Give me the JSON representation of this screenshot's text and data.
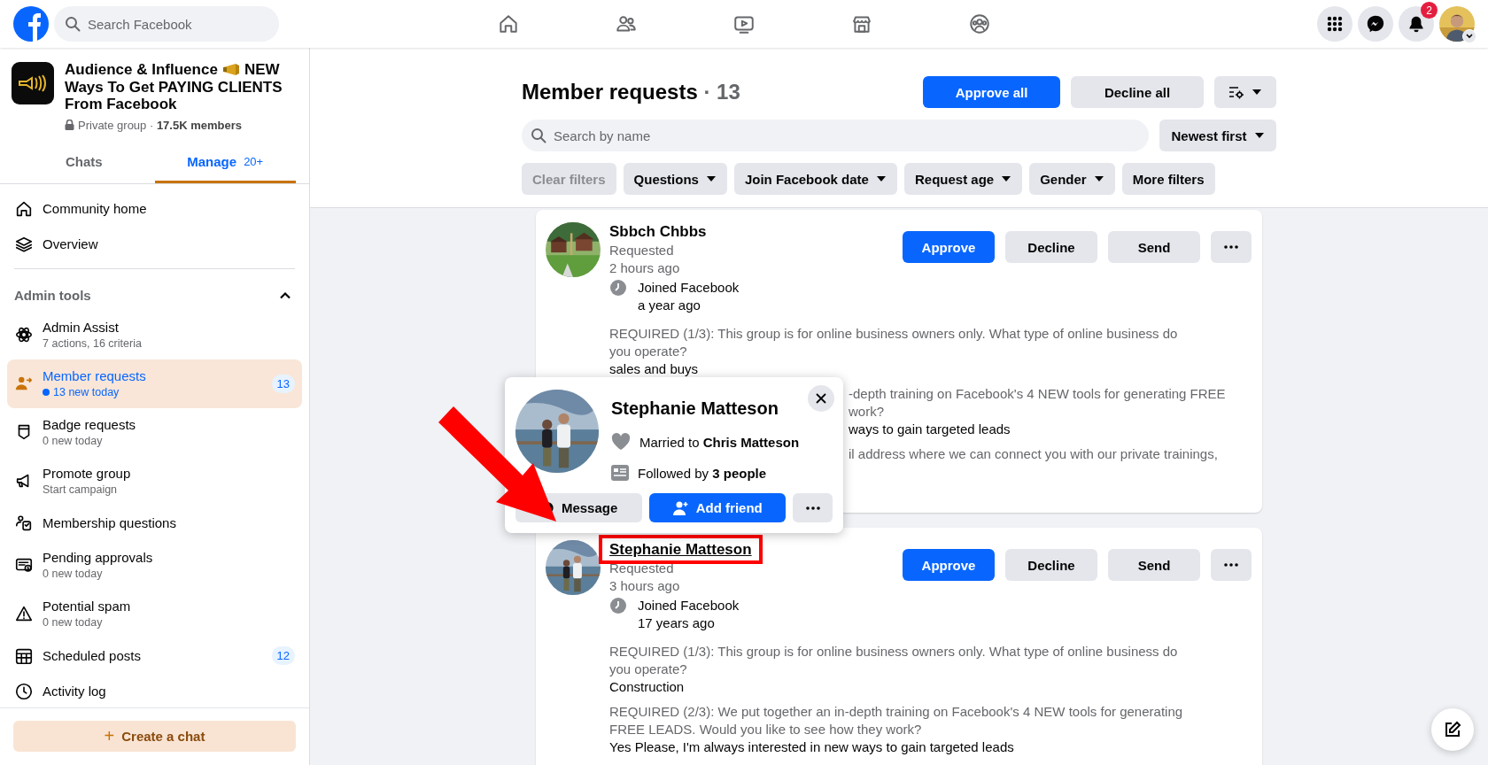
{
  "top_bar": {
    "search": {
      "placeholder": "Search Facebook"
    },
    "nav": [
      {
        "kind": "home"
      },
      {
        "kind": "friends"
      },
      {
        "kind": "video"
      },
      {
        "kind": "marketplace"
      },
      {
        "kind": "groups"
      }
    ],
    "notification_count": "2"
  },
  "group": {
    "name_parts": [
      "Audience & Influence",
      "NEW",
      "Ways To Get PAYING CLIENTS From Facebook"
    ],
    "meta": "Private group · **17.5K members**"
  },
  "tabs": [
    {
      "label": "Chats",
      "selected": false
    },
    {
      "label": "Manage",
      "badge": "20+",
      "selected": true
    }
  ],
  "menu": [
    {
      "kind": "home",
      "label": "Community home"
    },
    {
      "kind": "overview",
      "label": "Overview"
    }
  ],
  "admin_tools": {
    "title": "Admin tools",
    "expanded": true,
    "items": [
      {
        "kind": "admin-assist",
        "label": "Admin Assist",
        "detail": "7 actions, 16 criteria",
        "selected": false
      },
      {
        "kind": "member-requests",
        "label": "Member requests",
        "detail": "13 new today",
        "unread": true,
        "count": "13",
        "selected": true
      },
      {
        "kind": "badge",
        "label": "Badge requests",
        "detail": "0 new today",
        "selected": false
      },
      {
        "kind": "promote",
        "label": "Promote group",
        "detail": "Start campaign",
        "selected": false
      },
      {
        "kind": "questions",
        "label": "Membership questions",
        "selected": false
      },
      {
        "kind": "pending",
        "label": "Pending approvals",
        "detail": "0 new today",
        "selected": false
      },
      {
        "kind": "spam",
        "label": "Potential spam",
        "detail": "0 new today",
        "selected": false
      },
      {
        "kind": "scheduled",
        "label": "Scheduled posts",
        "count": "12",
        "selected": false
      },
      {
        "kind": "activity",
        "label": "Activity log",
        "selected": false
      }
    ]
  },
  "create_chat": {
    "icon": "+",
    "label": "Create a chat"
  },
  "requests_panel": {
    "title": "Member requests",
    "count": "· 13",
    "approve_all": "Approve all",
    "decline_all": "Decline all",
    "search": {
      "placeholder": "Search by name"
    },
    "sort": "Newest first",
    "filters": [
      {
        "label": "Clear filters",
        "disabled": true,
        "dropdown": false
      },
      {
        "label": "Questions",
        "disabled": false,
        "dropdown": true
      },
      {
        "label": "Join Facebook date",
        "disabled": false,
        "dropdown": true
      },
      {
        "label": "Request age",
        "disabled": false,
        "dropdown": true
      },
      {
        "label": "Gender",
        "disabled": false,
        "dropdown": true
      },
      {
        "label": "More filters",
        "disabled": false,
        "dropdown": false
      }
    ]
  },
  "requests": [
    {
      "name": "Sbbch Chbbs",
      "highlighted": false,
      "status": "Requested",
      "time": "2 hours ago",
      "joined_label": "Joined Facebook",
      "joined_value": "a year ago",
      "actions": [
        {
          "label": "Approve",
          "kind": "primary"
        },
        {
          "label": "Decline",
          "kind": "secondary"
        },
        {
          "label": "Send",
          "kind": "secondary"
        }
      ],
      "answers": [
        {
          "covered": false,
          "lines": [
            "REQUIRED (1/3): This group is for online business owners only. What type of online business do you operate?"
          ],
          "answer": "sales and buys"
        },
        {
          "covered": true,
          "lines": [
            "-depth training on Facebook's 4 NEW tools for generating FREE",
            "work?"
          ],
          "answer": "ways to gain targeted leads"
        },
        {
          "covered": true,
          "lines": [
            "il address where we can connect you with our private trainings,"
          ]
        }
      ]
    },
    {
      "name": "Stephanie Matteson",
      "highlighted": true,
      "status": "Requested",
      "time": "3 hours ago",
      "joined_label": "Joined Facebook",
      "joined_value": "17 years ago",
      "actions": [
        {
          "label": "Approve",
          "kind": "primary"
        },
        {
          "label": "Decline",
          "kind": "secondary"
        },
        {
          "label": "Send",
          "kind": "secondary"
        }
      ],
      "answers": [
        {
          "covered": false,
          "lines": [
            "REQUIRED (1/3): This group is for online business owners only. What type of online business do you operate?"
          ],
          "answer": "Construction"
        },
        {
          "covered": false,
          "lines": [
            "REQUIRED (2/3): We put together an in-depth training on Facebook's 4 NEW tools for generating FREE LEADS. Would you like to see how they work?"
          ],
          "answer": "Yes Please, I'm always interested in new ways to gain targeted leads"
        }
      ]
    }
  ],
  "profile_card": {
    "name": "Stephanie Matteson",
    "married": "Married to **Chris Matteson**",
    "followed": "Followed by **3 people**",
    "buttons": [
      {
        "label": "Message",
        "kind": "secondary"
      },
      {
        "label": "Add friend",
        "kind": "primary"
      }
    ]
  }
}
